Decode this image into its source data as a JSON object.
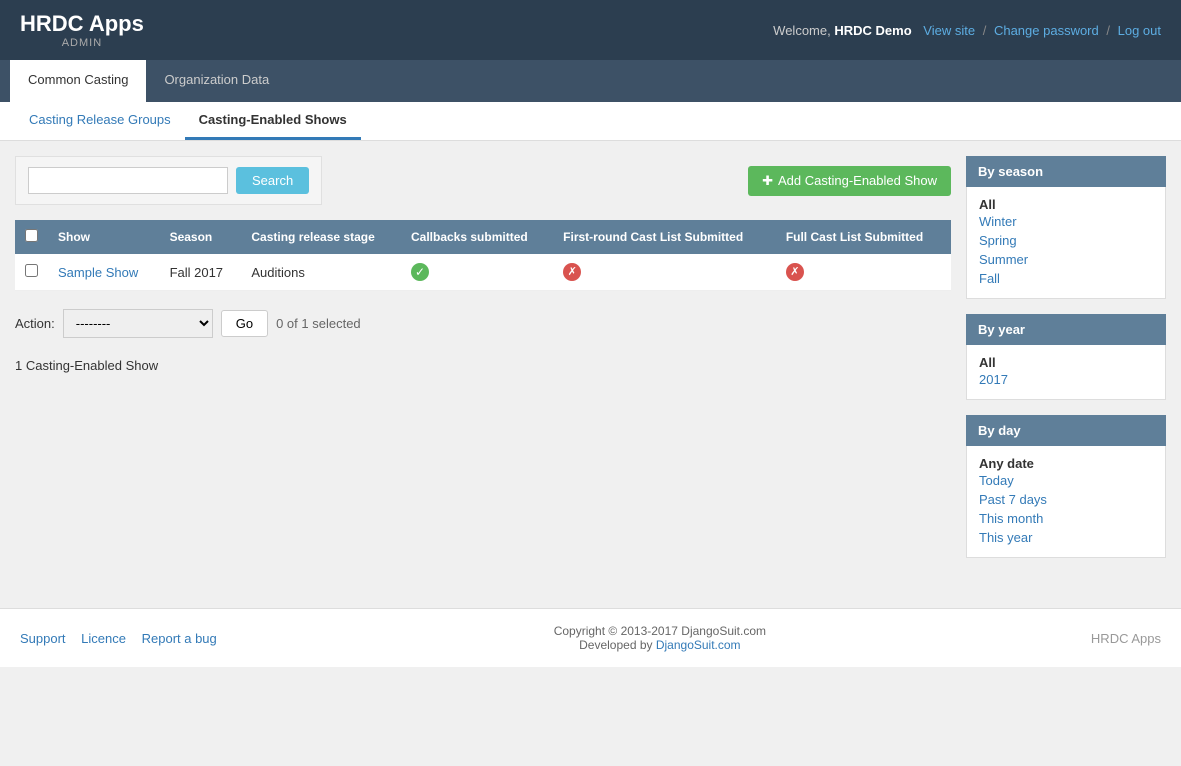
{
  "header": {
    "app_title": "HRDC Apps",
    "app_subtitle": "ADMIN",
    "welcome_text": "Welcome,",
    "username": "HRDC Demo",
    "view_site": "View site",
    "change_password": "Change password",
    "log_out": "Log out"
  },
  "nav_tabs": [
    {
      "id": "common-casting",
      "label": "Common Casting",
      "active": true
    },
    {
      "id": "organization-data",
      "label": "Organization Data",
      "active": false
    }
  ],
  "sub_tabs": [
    {
      "id": "casting-release-groups",
      "label": "Casting Release Groups",
      "active": false
    },
    {
      "id": "casting-enabled-shows",
      "label": "Casting-Enabled Shows",
      "active": true
    }
  ],
  "search": {
    "placeholder": "",
    "button_label": "Search"
  },
  "add_button": {
    "label": "Add Casting-Enabled Show",
    "icon": "+"
  },
  "table": {
    "columns": [
      "Show",
      "Season",
      "Casting release stage",
      "Callbacks submitted",
      "First-round Cast List Submitted",
      "Full Cast List Submitted"
    ],
    "rows": [
      {
        "show": "Sample Show",
        "season": "Fall 2017",
        "casting_release_stage": "Auditions",
        "callbacks_submitted": "yes",
        "first_round": "no",
        "full_cast": "no"
      }
    ]
  },
  "action": {
    "label": "Action:",
    "select_default": "--------",
    "go_label": "Go",
    "selected_text": "0 of 1 selected"
  },
  "count_text": "1 Casting-Enabled Show",
  "sidebar": {
    "by_season": {
      "header": "By season",
      "items": [
        {
          "label": "All",
          "active": true
        },
        {
          "label": "Winter",
          "active": false
        },
        {
          "label": "Spring",
          "active": false
        },
        {
          "label": "Summer",
          "active": false
        },
        {
          "label": "Fall",
          "active": false
        }
      ]
    },
    "by_year": {
      "header": "By year",
      "items": [
        {
          "label": "All",
          "active": true
        },
        {
          "label": "2017",
          "active": false
        }
      ]
    },
    "by_day": {
      "header": "By day",
      "items": [
        {
          "label": "Any date",
          "active": true
        },
        {
          "label": "Today",
          "active": false
        },
        {
          "label": "Past 7 days",
          "active": false
        },
        {
          "label": "This month",
          "active": false
        },
        {
          "label": "This year",
          "active": false
        }
      ]
    }
  },
  "footer": {
    "links": [
      "Support",
      "Licence",
      "Report a bug"
    ],
    "copyright": "Copyright © 2013-2017 DjangoSuit.com",
    "developed_by": "Developed by DjangoSuit.com",
    "brand": "HRDC Apps"
  }
}
